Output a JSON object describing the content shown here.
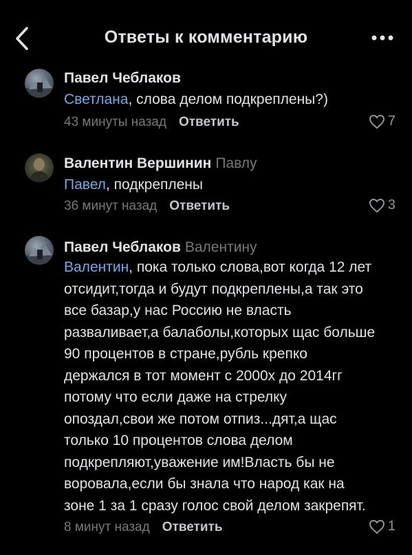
{
  "header": {
    "title": "Ответы к комментарию"
  },
  "comments": [
    {
      "author": "Павел Чеблаков",
      "reply_to": "",
      "mention": "Светлана",
      "text": ", слова делом подкреплены?)",
      "time": "43 минуты назад",
      "reply_label": "Ответить",
      "likes": "7"
    },
    {
      "author": "Валентин Вершинин",
      "reply_to": "Павлу",
      "mention": "Павел",
      "text": ", подкреплены",
      "time": "36 минут назад",
      "reply_label": "Ответить",
      "likes": "3"
    },
    {
      "author": "Павел Чеблаков",
      "reply_to": "Валентину",
      "mention": "Валентин",
      "text": ", пока только слова,вот когда 12 лет отсидит,тогда и будут подкреплены,а так это все базар,у нас Россию не власть разваливает,а балаболы,которых щас больше 90 процентов в стране,рубль крепко держался в тот момент с 2000х до 2014гг потому что если даже на стрелку опоздал,свои же потом отпиз...дят,а щас только 10 процентов слова делом подкрепляют,уважение им!Власть бы не воровала,если бы знала что народ как на зоне 1 за 1 сразу голос свой делом закрепят.",
      "time": "8 минут назад",
      "reply_label": "Ответить",
      "likes": "1"
    }
  ],
  "colors": {
    "background": "#000000",
    "text": "#e1e3e6",
    "secondary": "#76787a",
    "mention": "#71aaeb"
  },
  "icons": {
    "back": "chevron-left-icon",
    "more": "more-horizontal-icon",
    "like": "heart-outline-icon"
  }
}
